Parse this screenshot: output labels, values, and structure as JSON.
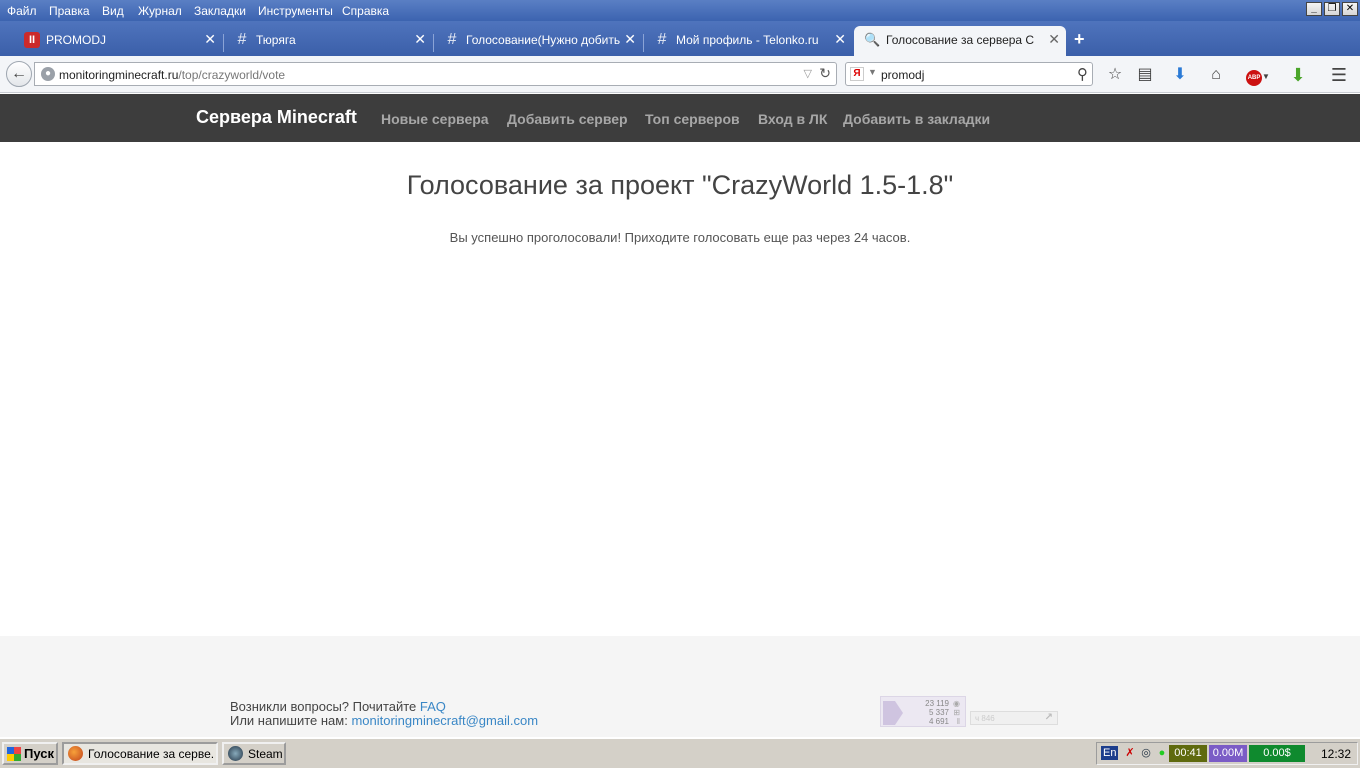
{
  "menubar": {
    "items": [
      "Файл",
      "Правка",
      "Вид",
      "Журнал",
      "Закладки",
      "Инструменты",
      "Справка"
    ],
    "window_buttons": [
      "_",
      "❐",
      "✕"
    ]
  },
  "tabs": [
    {
      "label": "PROMODJ",
      "icon": "promodj-icon"
    },
    {
      "label": "Тюряга",
      "icon": "hash-icon"
    },
    {
      "label": "Голосование(Нужно добить...",
      "icon": "hash-icon"
    },
    {
      "label": "Мой профиль - Telonko.ru",
      "icon": "hash-icon"
    },
    {
      "label": "Голосование за сервера Cra...",
      "icon": "search-icon",
      "active": true
    }
  ],
  "navbar": {
    "url_host": "monitoringminecraft.ru",
    "url_path": "/top/crazyworld/vote",
    "search_engine": "Я",
    "search_query": "promodj"
  },
  "site": {
    "brand": "Сервера Minecraft",
    "nav": [
      "Новые сервера",
      "Добавить сервер",
      "Топ серверов",
      "Вход в ЛК",
      "Добавить в закладки"
    ]
  },
  "content": {
    "headline": "Голосование за проект \"CrazyWorld 1.5-1.8\"",
    "message": "Вы успешно проголосовали! Приходите голосовать еще раз через 24 часов."
  },
  "footer": {
    "line1_text": "Возникли вопросы? Почитайте ",
    "line1_link": "FAQ",
    "line2_text": "Или напишите нам: ",
    "line2_link": "monitoringminecraft@gmail.com",
    "counter": [
      "23 119",
      "5 337",
      "4 691"
    ],
    "counter2": "ч 846"
  },
  "taskbar": {
    "start": "Пуск",
    "items": [
      {
        "label": "Голосование за серве...",
        "active": true
      },
      {
        "label": "Steam",
        "active": false
      }
    ],
    "tray": {
      "lang": "En",
      "time_box": "00:41",
      "mem_box": "0.00M",
      "money_box": "0.00$",
      "clock": "12:32"
    }
  }
}
